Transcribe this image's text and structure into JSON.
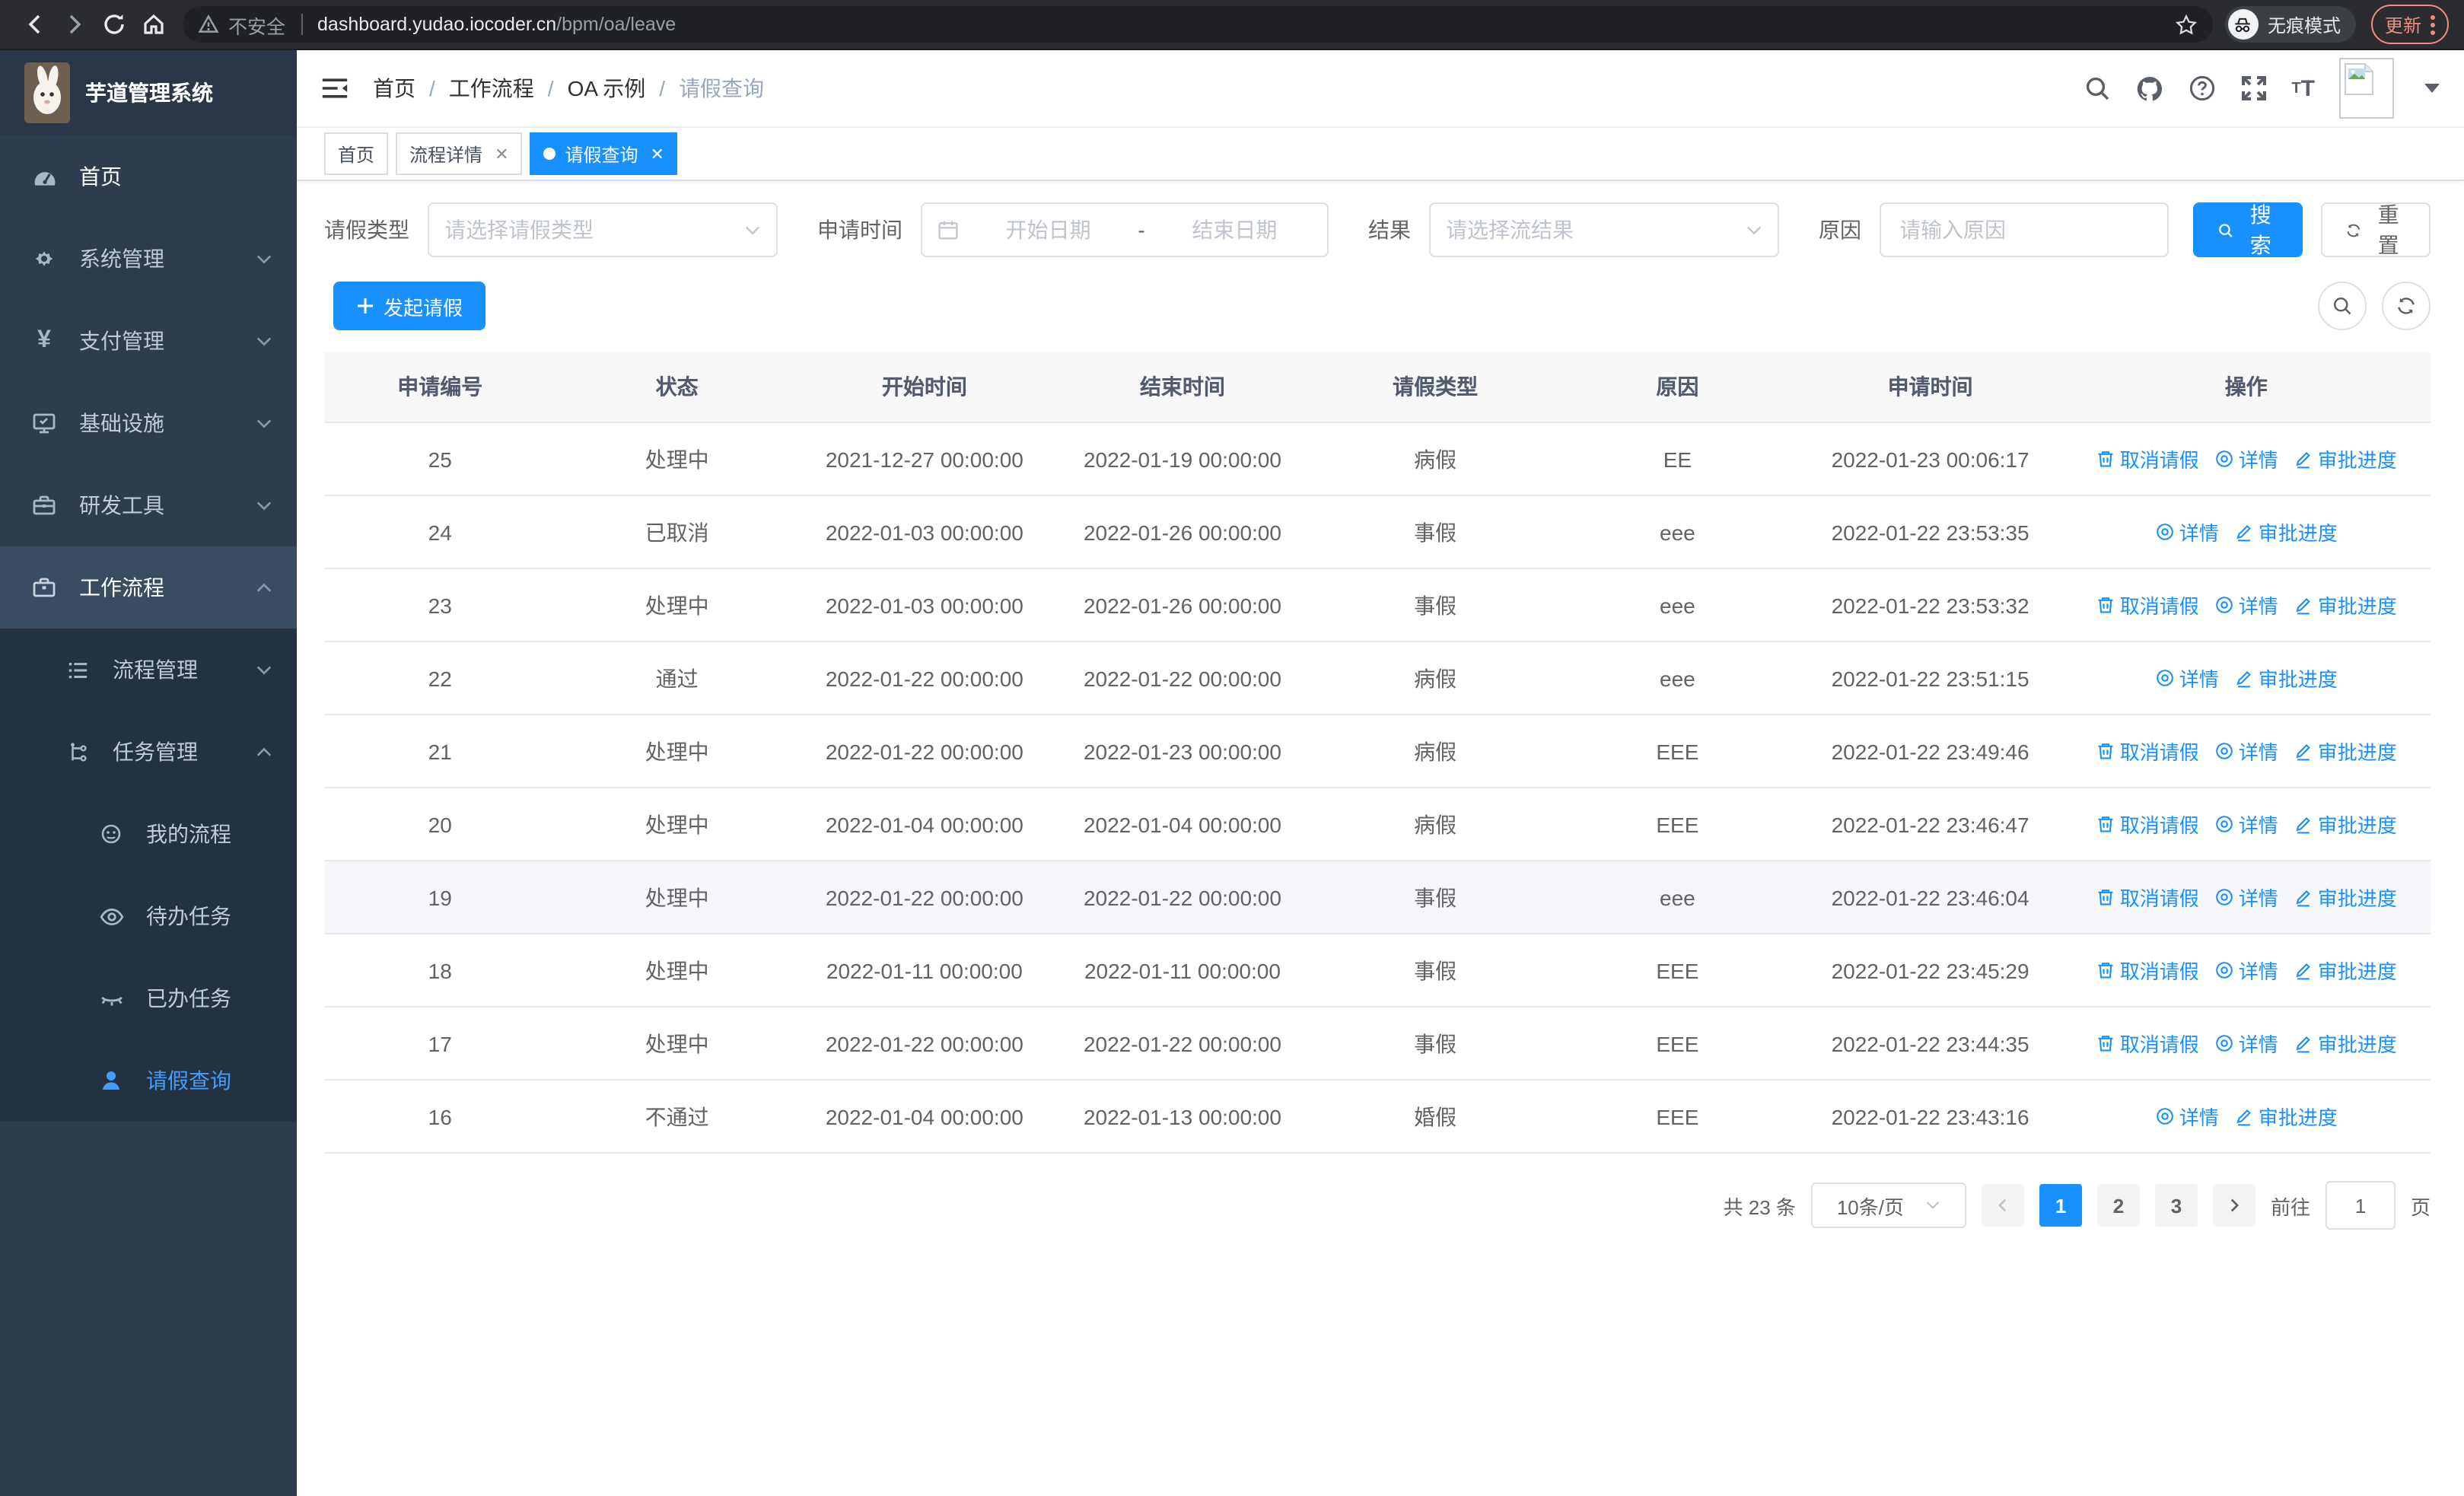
{
  "browser": {
    "security": "不安全",
    "url_host": "dashboard.yudao.iocoder.cn",
    "url_path": "/bpm/oa/leave",
    "incognito": "无痕模式",
    "update": "更新"
  },
  "app": {
    "title": "芋道管理系统"
  },
  "sidebar": {
    "items": [
      {
        "label": "首页"
      },
      {
        "label": "系统管理"
      },
      {
        "label": "支付管理"
      },
      {
        "label": "基础设施"
      },
      {
        "label": "研发工具"
      },
      {
        "label": "工作流程"
      },
      {
        "label": "流程管理"
      },
      {
        "label": "任务管理"
      },
      {
        "label": "我的流程"
      },
      {
        "label": "待办任务"
      },
      {
        "label": "已办任务"
      },
      {
        "label": "请假查询"
      }
    ]
  },
  "breadcrumb": [
    "首页",
    "工作流程",
    "OA 示例",
    "请假查询"
  ],
  "tabs": [
    {
      "label": "首页"
    },
    {
      "label": "流程详情"
    },
    {
      "label": "请假查询"
    }
  ],
  "filters": {
    "type_label": "请假类型",
    "type_placeholder": "请选择请假类型",
    "time_label": "申请时间",
    "start_placeholder": "开始日期",
    "range_separator": "-",
    "end_placeholder": "结束日期",
    "result_label": "结果",
    "result_placeholder": "请选择流结果",
    "reason_label": "原因",
    "reason_placeholder": "请输入原因",
    "search_label": "搜索",
    "reset_label": "重置"
  },
  "toolbar": {
    "create_label": "发起请假"
  },
  "table": {
    "columns": [
      "申请编号",
      "状态",
      "开始时间",
      "结束时间",
      "请假类型",
      "原因",
      "申请时间",
      "操作"
    ],
    "rows": [
      {
        "id": "25",
        "status": "处理中",
        "start": "2021-12-27 00:00:00",
        "end": "2022-01-19 00:00:00",
        "type": "病假",
        "reason": "EE",
        "apply_time": "2022-01-23 00:06:17",
        "actions": [
          "cancel",
          "detail",
          "progress"
        ],
        "highlighted": false
      },
      {
        "id": "24",
        "status": "已取消",
        "start": "2022-01-03 00:00:00",
        "end": "2022-01-26 00:00:00",
        "type": "事假",
        "reason": "eee",
        "apply_time": "2022-01-22 23:53:35",
        "actions": [
          "detail",
          "progress"
        ],
        "highlighted": false
      },
      {
        "id": "23",
        "status": "处理中",
        "start": "2022-01-03 00:00:00",
        "end": "2022-01-26 00:00:00",
        "type": "事假",
        "reason": "eee",
        "apply_time": "2022-01-22 23:53:32",
        "actions": [
          "cancel",
          "detail",
          "progress"
        ],
        "highlighted": false
      },
      {
        "id": "22",
        "status": "通过",
        "start": "2022-01-22 00:00:00",
        "end": "2022-01-22 00:00:00",
        "type": "病假",
        "reason": "eee",
        "apply_time": "2022-01-22 23:51:15",
        "actions": [
          "detail",
          "progress"
        ],
        "highlighted": false
      },
      {
        "id": "21",
        "status": "处理中",
        "start": "2022-01-22 00:00:00",
        "end": "2022-01-23 00:00:00",
        "type": "病假",
        "reason": "EEE",
        "apply_time": "2022-01-22 23:49:46",
        "actions": [
          "cancel",
          "detail",
          "progress"
        ],
        "highlighted": false
      },
      {
        "id": "20",
        "status": "处理中",
        "start": "2022-01-04 00:00:00",
        "end": "2022-01-04 00:00:00",
        "type": "病假",
        "reason": "EEE",
        "apply_time": "2022-01-22 23:46:47",
        "actions": [
          "cancel",
          "detail",
          "progress"
        ],
        "highlighted": false
      },
      {
        "id": "19",
        "status": "处理中",
        "start": "2022-01-22 00:00:00",
        "end": "2022-01-22 00:00:00",
        "type": "事假",
        "reason": "eee",
        "apply_time": "2022-01-22 23:46:04",
        "actions": [
          "cancel",
          "detail",
          "progress"
        ],
        "highlighted": true
      },
      {
        "id": "18",
        "status": "处理中",
        "start": "2022-01-11 00:00:00",
        "end": "2022-01-11 00:00:00",
        "type": "事假",
        "reason": "EEE",
        "apply_time": "2022-01-22 23:45:29",
        "actions": [
          "cancel",
          "detail",
          "progress"
        ],
        "highlighted": false
      },
      {
        "id": "17",
        "status": "处理中",
        "start": "2022-01-22 00:00:00",
        "end": "2022-01-22 00:00:00",
        "type": "事假",
        "reason": "EEE",
        "apply_time": "2022-01-22 23:44:35",
        "actions": [
          "cancel",
          "detail",
          "progress"
        ],
        "highlighted": false
      },
      {
        "id": "16",
        "status": "不通过",
        "start": "2022-01-04 00:00:00",
        "end": "2022-01-13 00:00:00",
        "type": "婚假",
        "reason": "EEE",
        "apply_time": "2022-01-22 23:43:16",
        "actions": [
          "detail",
          "progress"
        ],
        "highlighted": false
      }
    ]
  },
  "action_labels": {
    "cancel": "取消请假",
    "detail": "详情",
    "progress": "审批进度"
  },
  "pagination": {
    "total_label": "共 23 条",
    "page_size": "10条/页",
    "pages": [
      "1",
      "2",
      "3"
    ],
    "active_page": "1",
    "goto_label": "前往",
    "goto_value": "1",
    "unit_label": "页"
  },
  "colors": {
    "primary": "#1890ff",
    "menu_active": "#409eff",
    "update_accent": "#f28b82"
  }
}
